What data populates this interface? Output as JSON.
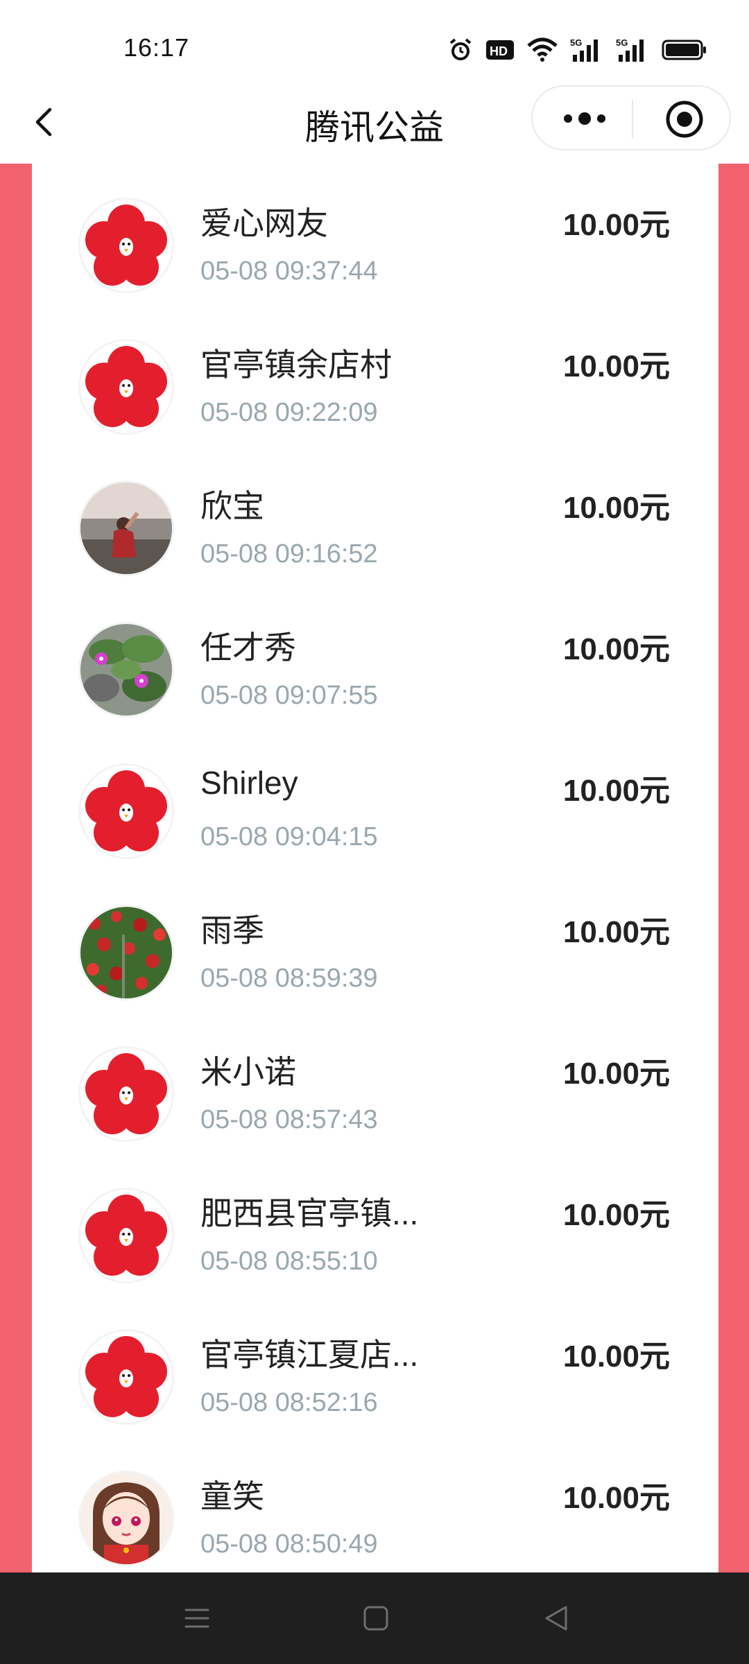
{
  "status_bar": {
    "time": "16:17",
    "icons": [
      "alarm-icon",
      "hd-icon",
      "wifi-icon",
      "signal-5g-icon",
      "signal-5g-icon",
      "battery-icon"
    ]
  },
  "nav": {
    "title": "腾讯公益",
    "left_icon": "back-icon",
    "capsule_icons": [
      "more-icon",
      "close-miniprogram-icon"
    ]
  },
  "colors": {
    "background_red": "#f2626f",
    "amount_text": "#222222",
    "time_text": "#9aa7ae"
  },
  "donations": [
    {
      "name": "爱心网友",
      "time": "05-08 09:37:44",
      "amount": "10.00元",
      "avatar": "default-flower"
    },
    {
      "name": "官亭镇余店村",
      "time": "05-08 09:22:09",
      "amount": "10.00元",
      "avatar": "default-flower"
    },
    {
      "name": "欣宝",
      "time": "05-08 09:16:52",
      "amount": "10.00元",
      "avatar": "child-photo"
    },
    {
      "name": "任才秀",
      "time": "05-08 09:07:55",
      "amount": "10.00元",
      "avatar": "flowers-photo"
    },
    {
      "name": "Shirley",
      "time": "05-08 09:04:15",
      "amount": "10.00元",
      "avatar": "default-flower"
    },
    {
      "name": "雨季",
      "time": "05-08 08:59:39",
      "amount": "10.00元",
      "avatar": "roses-photo"
    },
    {
      "name": "米小诺",
      "time": "05-08 08:57:43",
      "amount": "10.00元",
      "avatar": "default-flower"
    },
    {
      "name": "肥西县官亭镇...",
      "time": "05-08 08:55:10",
      "amount": "10.00元",
      "avatar": "default-flower"
    },
    {
      "name": "官亭镇江夏店...",
      "time": "05-08 08:52:16",
      "amount": "10.00元",
      "avatar": "default-flower"
    },
    {
      "name": "童笑",
      "time": "05-08 08:50:49",
      "amount": "10.00元",
      "avatar": "cartoon-girl"
    }
  ],
  "system_nav": [
    "menu-icon",
    "home-icon",
    "back-triangle-icon"
  ]
}
